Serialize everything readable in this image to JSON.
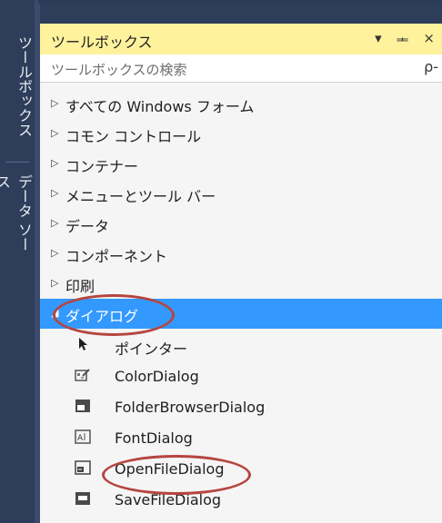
{
  "side_tabs": [
    "ツールボックス",
    "データ ソース"
  ],
  "toolbox": {
    "title": "ツールボックス",
    "ctrl_dropdown": "▾",
    "ctrl_pin": "ᆂ",
    "ctrl_close": "×",
    "search_placeholder": "ツールボックスの検索",
    "search_icon": "ρ-"
  },
  "categories": [
    {
      "label": "すべての Windows フォーム",
      "expanded": false
    },
    {
      "label": "コモン コントロール",
      "expanded": false
    },
    {
      "label": "コンテナー",
      "expanded": false
    },
    {
      "label": "メニューとツール バー",
      "expanded": false
    },
    {
      "label": "データ",
      "expanded": false
    },
    {
      "label": "コンポーネント",
      "expanded": false
    },
    {
      "label": "印刷",
      "expanded": false
    },
    {
      "label": "ダイアログ",
      "expanded": true,
      "selected": true
    }
  ],
  "dialog_items": [
    {
      "label": "ポインター",
      "icon": "pointer-icon"
    },
    {
      "label": "ColorDialog",
      "icon": "color-dialog-icon"
    },
    {
      "label": "FolderBrowserDialog",
      "icon": "folder-browser-dialog-icon"
    },
    {
      "label": "FontDialog",
      "icon": "font-dialog-icon"
    },
    {
      "label": "OpenFileDialog",
      "icon": "open-file-dialog-icon"
    },
    {
      "label": "SaveFileDialog",
      "icon": "save-file-dialog-icon"
    }
  ],
  "colors": {
    "selection": "#3399ff",
    "title_bar": "#fff29d",
    "highlight_ring": "#b5463f"
  }
}
